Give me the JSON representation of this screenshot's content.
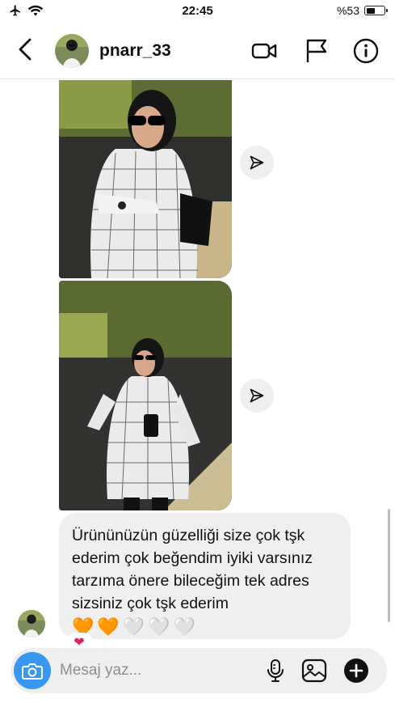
{
  "status_bar": {
    "time": "22:45",
    "battery_text": "%53",
    "battery_level": 0.53,
    "icons": [
      "airplane-icon",
      "wifi-icon",
      "battery-icon"
    ]
  },
  "header": {
    "username": "pnarr_33",
    "icons": [
      "back-arrow-icon",
      "video-call-icon",
      "flag-icon",
      "info-icon"
    ]
  },
  "messages": [
    {
      "type": "photo",
      "description_icon": "share-icon"
    },
    {
      "type": "photo",
      "description_icon": "share-icon"
    },
    {
      "type": "text",
      "text": "Ürününüzün güzelliği size çok tşk ederim çok beğendim iyiki varsınız tarzıma önere bileceğim tek adres sizsiniz çok tşk ederim",
      "emoji": [
        "🧡",
        "🧡",
        "🤍",
        "🤍",
        "🤍"
      ],
      "reaction": "❤"
    }
  ],
  "composer": {
    "placeholder": "Mesaj yaz...",
    "icons": [
      "camera-icon",
      "microphone-icon",
      "gallery-icon",
      "add-icon"
    ]
  },
  "colors": {
    "accent": "#3897f0",
    "bubble": "#efefef",
    "heart_orange": "#f28b1b",
    "heart_red": "#e0245e"
  }
}
